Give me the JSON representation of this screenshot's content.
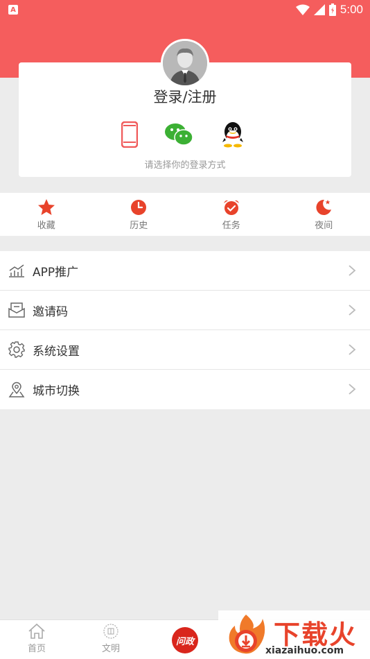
{
  "status_bar": {
    "left_badge": "A",
    "time": "5:00",
    "icons": [
      "wifi-icon",
      "signal-icon",
      "battery-icon"
    ]
  },
  "login": {
    "title": "登录/注册",
    "hint": "请选择你的登录方式",
    "methods": [
      "phone-icon",
      "wechat-icon",
      "qq-icon"
    ]
  },
  "quick_actions": [
    {
      "label": "收藏",
      "icon": "star-icon"
    },
    {
      "label": "历史",
      "icon": "clock-icon"
    },
    {
      "label": "任务",
      "icon": "alarm-icon"
    },
    {
      "label": "夜间",
      "icon": "moon-icon"
    }
  ],
  "menu": [
    {
      "label": "APP推广",
      "icon": "chart-icon"
    },
    {
      "label": "邀请码",
      "icon": "envelope-icon"
    },
    {
      "label": "系统设置",
      "icon": "gear-icon"
    },
    {
      "label": "城市切换",
      "icon": "location-icon"
    }
  ],
  "bottom_nav": {
    "home": "首页",
    "civilization": "文明",
    "center": "问政"
  },
  "watermark": {
    "brand": "下载火",
    "url": "xiazaihuo.com"
  },
  "colors": {
    "accent": "#f55d5d",
    "icon_red": "#e8432b",
    "background": "#ececec"
  }
}
